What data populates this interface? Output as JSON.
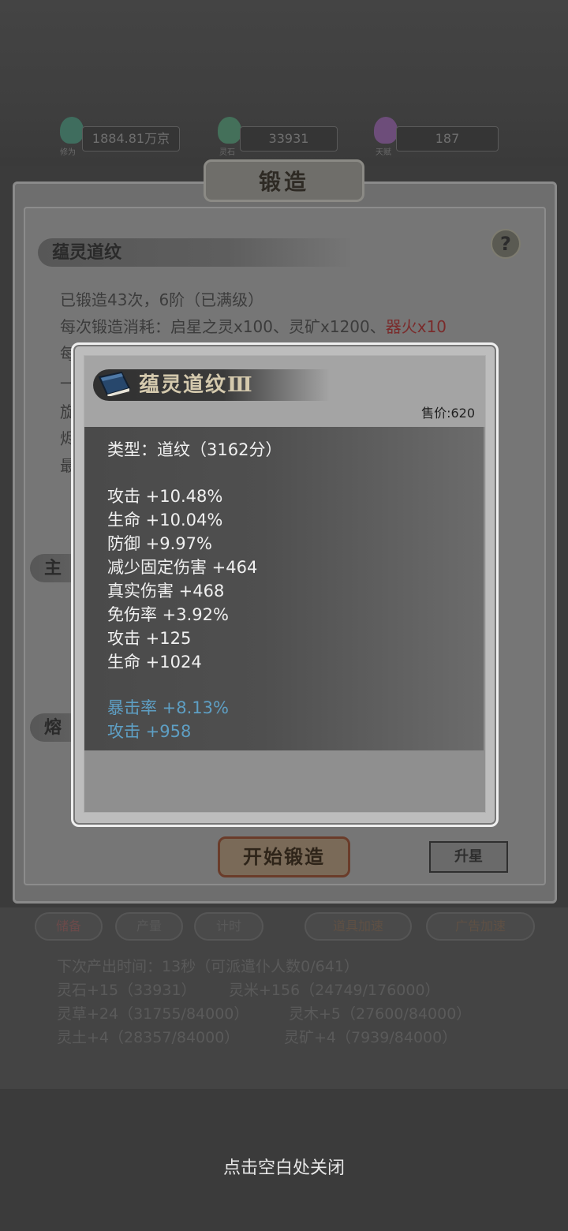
{
  "resources": [
    {
      "label": "修为",
      "value": "1884.81万京",
      "color": "#3f6d5e"
    },
    {
      "label": "灵石",
      "value": "33931",
      "color": "#44705a"
    },
    {
      "label": "天赋",
      "value": "187",
      "color": "#6d4d7a"
    }
  ],
  "forge": {
    "title": "锻造",
    "help_label": "?",
    "section_title": "蕴灵道纹",
    "line1": "已锻造43次，6阶（已满级）",
    "line2_prefix": "每次锻造消耗：启星之灵x100、灵矿x1200、",
    "line2_red": "器火x10",
    "side_chars": [
      "每",
      "一",
      "旋",
      "烬",
      "最"
    ],
    "section2_char": "主",
    "section3_char": "熔",
    "start_button": "开始锻造",
    "upgrade_button": "升星"
  },
  "production": {
    "tabs": [
      "储备",
      "产量",
      "计时",
      "道具加速",
      "广告加速"
    ],
    "next_time": "下次产出时间：13秒（可派遣仆人数0/641）",
    "rows": [
      [
        "灵石+15（33931）",
        "灵米+156（24749/176000）"
      ],
      [
        "灵草+24（31755/84000）",
        "灵木+5（27600/84000）"
      ],
      [
        "灵土+4（28357/84000）",
        "灵矿+4（7939/84000）"
      ]
    ]
  },
  "item": {
    "name": "蕴灵道纹Ⅲ",
    "icon": "book-icon",
    "price": "售价:620",
    "type_line": "类型：道纹（3162分）",
    "stats": [
      "攻击 +10.48%",
      "生命 +10.04%",
      "防御 +9.97%",
      "减少固定伤害 +464",
      "真实伤害 +468",
      "免伤率 +3.92%",
      "攻击 +125",
      "生命 +1024"
    ],
    "special_stats": [
      "暴击率 +8.13%",
      "攻击 +958"
    ],
    "special_color": "#5e9fc4"
  },
  "close_hint": "点击空白处关闭"
}
